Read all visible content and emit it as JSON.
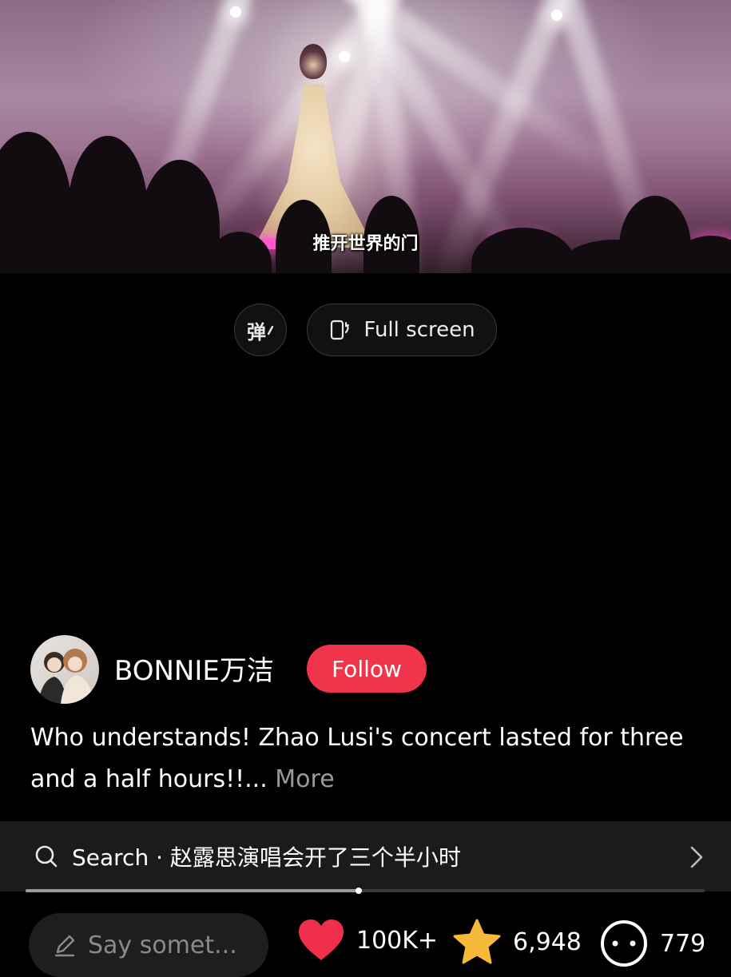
{
  "video": {
    "subtitle": "推开世界的门"
  },
  "controls": {
    "danmu_label": "弹",
    "fullscreen_label": "Full screen",
    "fullscreen_icon": "rotate-phone-icon"
  },
  "author": {
    "name": "BONNIE万洁",
    "follow_label": "Follow"
  },
  "caption": {
    "text": "Who understands! Zhao Lusi's concert lasted for three and a half hours!!...",
    "more_label": "More"
  },
  "search": {
    "text": "Search · 赵露思演唱会开了三个半小时",
    "icon": "search-icon",
    "chevron": "chevron-right-icon"
  },
  "progress": {
    "fraction": 0.49
  },
  "bottom_bar": {
    "comment_placeholder": "Say somet...",
    "likes": "100K+",
    "favorites": "6,948",
    "comments": "779"
  },
  "colors": {
    "accent": "#f0344c",
    "like": "#ef2f4b",
    "favorite": "#f7b93a",
    "background": "#000000"
  }
}
